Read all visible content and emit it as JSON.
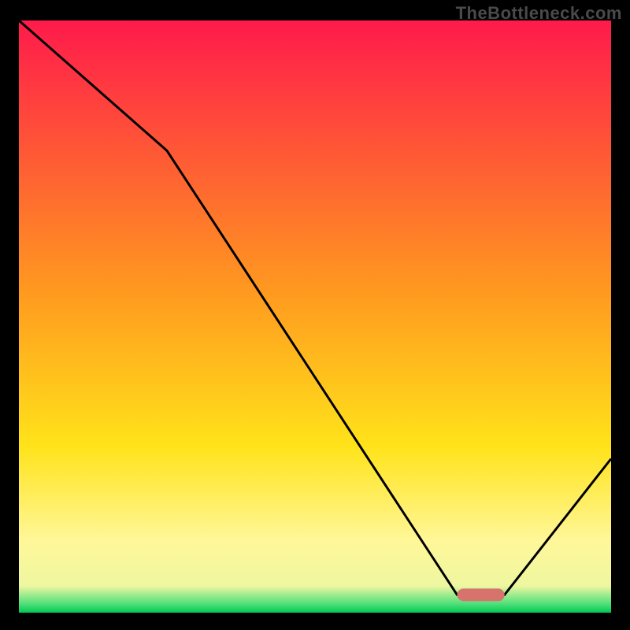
{
  "watermark": "TheBottleneck.com",
  "chart_data": {
    "type": "line",
    "title": "",
    "xlabel": "",
    "ylabel": "",
    "xlim": [
      0,
      100
    ],
    "ylim": [
      0,
      100
    ],
    "x": [
      0,
      25,
      74,
      82,
      100
    ],
    "values": [
      100,
      78,
      3,
      3,
      26
    ],
    "marker": {
      "x_range": [
        74,
        82
      ],
      "y": 3,
      "color": "#d7736d"
    },
    "gradient_stops": [
      {
        "pos": 0.0,
        "color": "#ff1a4b"
      },
      {
        "pos": 0.46,
        "color": "#ff9a1f"
      },
      {
        "pos": 0.72,
        "color": "#ffe31a"
      },
      {
        "pos": 0.88,
        "color": "#fff79a"
      },
      {
        "pos": 0.955,
        "color": "#eef7a0"
      },
      {
        "pos": 0.985,
        "color": "#4fe07a"
      },
      {
        "pos": 1.0,
        "color": "#00c853"
      }
    ],
    "curve_color": "#000000",
    "curve_width": 3
  }
}
